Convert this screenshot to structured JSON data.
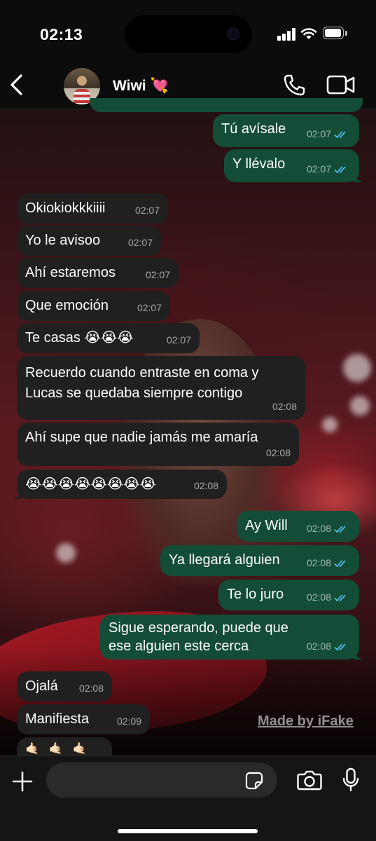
{
  "status_bar": {
    "time": "02:13"
  },
  "header": {
    "contact_name": "Wiwi 💘"
  },
  "messages": [
    {
      "side": "out",
      "text": "Tú avísale",
      "time": "02:07",
      "read": true
    },
    {
      "side": "out",
      "text": "Y llévalo",
      "time": "02:07",
      "read": true
    },
    {
      "side": "in",
      "text": "Okiokiokkkiiii",
      "time": "02:07"
    },
    {
      "side": "in",
      "text": "Yo le avisoo",
      "time": "02:07"
    },
    {
      "side": "in",
      "text": "Ahí estaremos",
      "time": "02:07"
    },
    {
      "side": "in",
      "text": "Que emoción",
      "time": "02:07"
    },
    {
      "side": "in",
      "text": "Te casas 😭😭😭",
      "time": "02:07"
    },
    {
      "side": "in",
      "text": "Recuerdo cuando entraste en coma y Lucas se quedaba siempre contigo",
      "time": "02:08"
    },
    {
      "side": "in",
      "text": "Ahí supe que nadie jamás me amaría",
      "time": "02:08"
    },
    {
      "side": "in",
      "text": "😭😭😭😭😭😭😭😭",
      "time": "02:08"
    },
    {
      "side": "out",
      "text": "Ay Will",
      "time": "02:08",
      "read": true
    },
    {
      "side": "out",
      "text": "Ya llegará alguien",
      "time": "02:08",
      "read": true
    },
    {
      "side": "out",
      "text": "Te lo juro",
      "time": "02:08",
      "read": true
    },
    {
      "side": "out",
      "text": "Sigue esperando, puede que ese alguien este cerca",
      "time": "02:08",
      "read": true
    },
    {
      "side": "in",
      "text": "Ojalá",
      "time": "02:08"
    },
    {
      "side": "in",
      "text": "Manifiesta",
      "time": "02:09"
    },
    {
      "side": "in",
      "text": "🤙🏻🤙🏻🤙🏻",
      "time": ""
    }
  ],
  "watermark": "Made by iFake",
  "colors": {
    "outgoing_bubble": "#134d37",
    "incoming_bubble": "#202020",
    "read_ticks": "#53bdeb"
  },
  "icons": [
    "back-chevron-icon",
    "phone-icon",
    "video-camera-icon",
    "plus-icon",
    "sticker-icon",
    "camera-icon",
    "microphone-icon"
  ]
}
